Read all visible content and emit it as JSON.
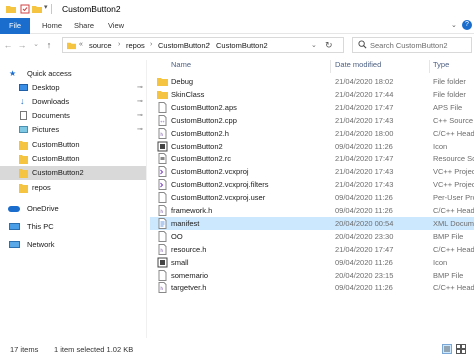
{
  "window": {
    "title": "CustomButton2"
  },
  "ribbon": {
    "tabs": [
      "File",
      "Home",
      "Share",
      "View"
    ]
  },
  "address": {
    "crumbs": [
      "source",
      "repos",
      "CustomButton2",
      "CustomButton2"
    ],
    "search_placeholder": "Search CustomButton2"
  },
  "nav": {
    "items": [
      {
        "label": "Quick access",
        "icon": "star-icon",
        "pinned": false
      },
      {
        "label": "Desktop",
        "icon": "desktop-icon",
        "pinned": true
      },
      {
        "label": "Downloads",
        "icon": "download-icon",
        "pinned": true
      },
      {
        "label": "Documents",
        "icon": "document-icon",
        "pinned": true
      },
      {
        "label": "Pictures",
        "icon": "pictures-icon",
        "pinned": true
      },
      {
        "label": "CustomButton",
        "icon": "folder-icon",
        "pinned": false
      },
      {
        "label": "CustomButton",
        "icon": "folder-icon",
        "pinned": false
      },
      {
        "label": "CustomButton2",
        "icon": "folder-icon",
        "pinned": false
      },
      {
        "label": "repos",
        "icon": "folder-icon",
        "pinned": false
      },
      {
        "label": "OneDrive",
        "icon": "cloud-icon",
        "pinned": false
      },
      {
        "label": "This PC",
        "icon": "computer-icon",
        "pinned": false
      },
      {
        "label": "Network",
        "icon": "network-icon",
        "pinned": false
      }
    ]
  },
  "files": {
    "columns": [
      "Name",
      "Date modified",
      "Type"
    ],
    "rows": [
      {
        "name": "Debug",
        "date": "21/04/2020 18:02",
        "type": "File folder",
        "icon": "folder-icon"
      },
      {
        "name": "SkinClass",
        "date": "21/04/2020 17:44",
        "type": "File folder",
        "icon": "folder-icon"
      },
      {
        "name": "CustomButton2.aps",
        "date": "21/04/2020 17:47",
        "type": "APS File",
        "icon": "file-icon"
      },
      {
        "name": "CustomButton2.cpp",
        "date": "21/04/2020 17:43",
        "type": "C++ Source",
        "icon": "cpp-file-icon"
      },
      {
        "name": "CustomButton2.h",
        "date": "21/04/2020 18:00",
        "type": "C/C++ Head",
        "icon": "header-file-icon"
      },
      {
        "name": "CustomButton2",
        "date": "09/04/2020 11:26",
        "type": "Icon",
        "icon": "app-icon"
      },
      {
        "name": "CustomButton2.rc",
        "date": "21/04/2020 17:47",
        "type": "Resource Sc",
        "icon": "rc-file-icon"
      },
      {
        "name": "CustomButton2.vcxproj",
        "date": "21/04/2020 17:43",
        "type": "VC++ Project",
        "icon": "vcxproj-icon"
      },
      {
        "name": "CustomButton2.vcxproj.filters",
        "date": "21/04/2020 17:43",
        "type": "VC++ Projec",
        "icon": "vcxproj-icon"
      },
      {
        "name": "CustomButton2.vcxproj.user",
        "date": "09/04/2020 11:26",
        "type": "Per-User Pro",
        "icon": "file-icon"
      },
      {
        "name": "framework.h",
        "date": "09/04/2020 11:26",
        "type": "C/C++ Head",
        "icon": "header-file-icon"
      },
      {
        "name": "manifest",
        "date": "20/04/2020 00:54",
        "type": "XML Docum",
        "icon": "xml-file-icon",
        "selected": true
      },
      {
        "name": "OO",
        "date": "20/04/2020 23:30",
        "type": "BMP File",
        "icon": "bitmap-icon"
      },
      {
        "name": "resource.h",
        "date": "21/04/2020 17:47",
        "type": "C/C++ Head",
        "icon": "header-file-icon"
      },
      {
        "name": "small",
        "date": "09/04/2020 11:26",
        "type": "Icon",
        "icon": "app-icon"
      },
      {
        "name": "somemario",
        "date": "20/04/2020 23:15",
        "type": "BMP File",
        "icon": "bitmap-icon"
      },
      {
        "name": "targetver.h",
        "date": "09/04/2020 11:26",
        "type": "C/C++ Head",
        "icon": "header-file-icon"
      }
    ]
  },
  "status": {
    "item_count": "17 items",
    "selection": "1 item selected  1.02 KB"
  },
  "colors": {
    "accent": "#1a6dcc",
    "selected_row": "#cce8ff",
    "selected_nav": "#d9d9d9",
    "folder": "#f5c542"
  }
}
